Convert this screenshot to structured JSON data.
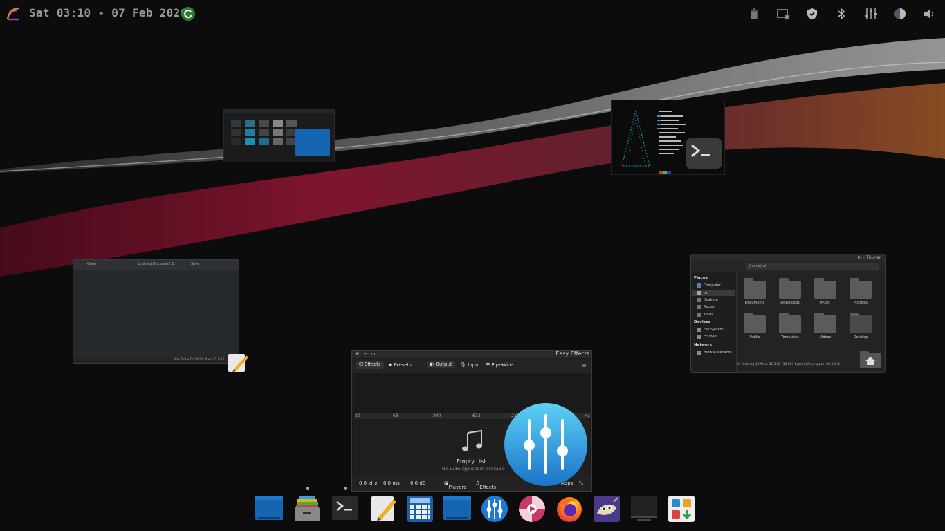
{
  "topbar": {
    "logo_icon": "endeavouros-logo-icon",
    "clock": "Sat 03:10 - 07 Feb 2026",
    "update_icon": "update-available-icon",
    "tray_icons": [
      "battery-icon",
      "screenshot-icon",
      "shield-icon",
      "bluetooth-icon",
      "equalizer-icon",
      "brightness-icon",
      "volume-icon"
    ]
  },
  "windows": {
    "photo_viewer": {
      "icon": "image-viewer-window"
    },
    "terminal": {
      "icon": "terminal-icon"
    },
    "text_editor": {
      "title": "Untitled Document 1",
      "menu_left": "Open",
      "menu_right": "Save",
      "status": "Plain Text ▾   Tab Width: 8 ▾    Ln 1, Col 1"
    },
    "thunar": {
      "title": "tn - Thunar",
      "path": "/home/tn/",
      "sections": {
        "places": "Places",
        "devices": "Devices",
        "network": "Network"
      },
      "places_items": [
        "Computer",
        "tn",
        "Desktop",
        "Recent",
        "Trash"
      ],
      "devices_items": [
        "File System",
        "EFI/boot"
      ],
      "network_items": [
        "Browse Network"
      ],
      "folders": [
        "Documents",
        "Downloads",
        "Music",
        "Pictures",
        "Public",
        "Templates",
        "Videos",
        "Desktop"
      ],
      "footer": "21 folders  |  10 files: 31.3 kB (32,053 bytes)  |  Free space: 96.3 GiB"
    },
    "easy_effects": {
      "title": "Easy Effects",
      "tabs": [
        "Effects",
        "Presets",
        "Output",
        "Input",
        "PipeWire"
      ],
      "freq_labels": [
        "20",
        "63",
        "200",
        "632",
        "2.0",
        "Hz"
      ],
      "empty_title": "Empty List",
      "empty_subtitle": "No audio application available",
      "footer": {
        "rate": "0.0 kHz",
        "latency": "0.0 ms",
        "level": "0   0 dB",
        "players": "Players",
        "effects": "Effects",
        "apps": "Apps"
      }
    }
  },
  "dock": {
    "items": [
      {
        "name": "dock-desktop-blue",
        "icon": "desktop-icon"
      },
      {
        "name": "dock-files",
        "icon": "file-cabinet-icon"
      },
      {
        "name": "dock-terminal",
        "icon": "terminal-icon"
      },
      {
        "name": "dock-text-editor",
        "icon": "text-editor-icon"
      },
      {
        "name": "dock-calculator",
        "icon": "calculator-icon"
      },
      {
        "name": "dock-desktop-2",
        "icon": "desktop-icon"
      },
      {
        "name": "dock-easyeffects",
        "icon": "equalizer-icon"
      },
      {
        "name": "dock-media-player",
        "icon": "media-player-icon"
      },
      {
        "name": "dock-firefox",
        "icon": "firefox-icon"
      },
      {
        "name": "dock-gimp",
        "icon": "gimp-icon"
      },
      {
        "name": "dock-screen",
        "icon": "display-icon"
      },
      {
        "name": "dock-software",
        "icon": "software-store-icon"
      }
    ]
  }
}
